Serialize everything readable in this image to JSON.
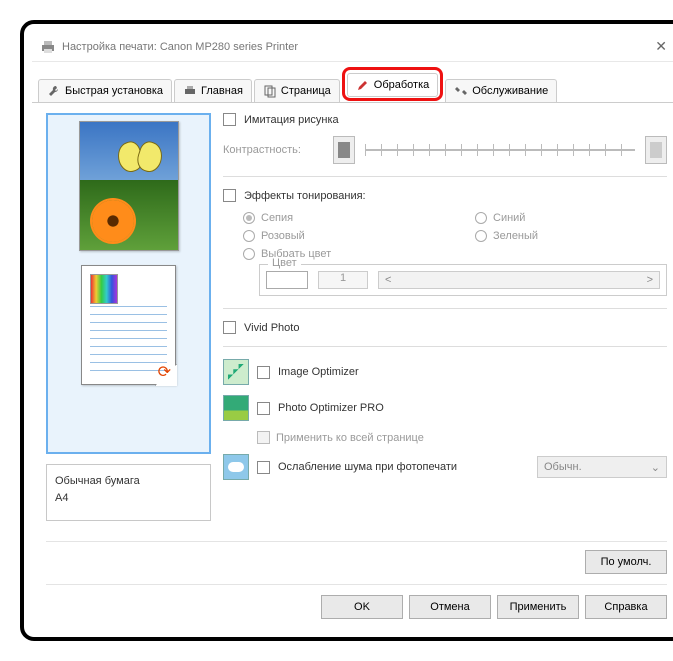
{
  "window": {
    "title": "Настройка печати: Canon MP280 series Printer"
  },
  "tabs": {
    "quick": "Быстрая установка",
    "main": "Главная",
    "page": "Страница",
    "effects": "Обработка",
    "maint": "Обслуживание"
  },
  "left": {
    "paper_type": "Обычная бумага",
    "paper_size": "A4"
  },
  "imitation": {
    "label": "Имитация рисунка",
    "contrast": "Контрастность:"
  },
  "toning": {
    "label": "Эффекты тонирования:",
    "sepia": "Сепия",
    "blue": "Синий",
    "pink": "Розовый",
    "green": "Зеленый",
    "pick": "Выбрать цвет",
    "color_legend": "Цвет",
    "value": "1",
    "left_arrow": "<",
    "right_arrow": ">"
  },
  "vivid": {
    "label": "Vivid Photo"
  },
  "opts": {
    "img_opt": "Image Optimizer",
    "photo_opt": "Photo Optimizer PRO",
    "apply_all": "Применить ко всей странице",
    "noise": "Ослабление шума при фотопечати",
    "noise_level": "Обычн."
  },
  "buttons": {
    "defaults": "По умолч.",
    "ok": "OK",
    "cancel": "Отмена",
    "apply": "Применить",
    "help": "Справка"
  }
}
